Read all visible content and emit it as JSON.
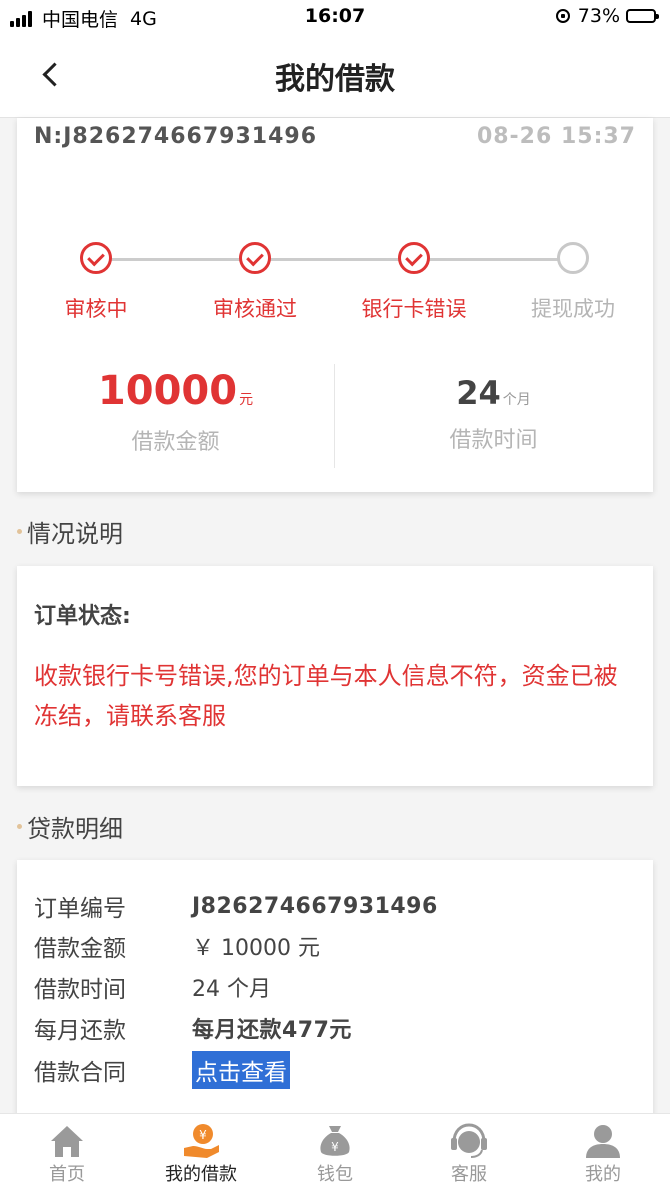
{
  "status_bar": {
    "carrier": "中国电信",
    "network": "4G",
    "time": "16:07",
    "battery": "73%"
  },
  "header": {
    "title": "我的借款"
  },
  "order": {
    "number": "N:J826274667931496",
    "time": "08-26 15:37",
    "steps": [
      {
        "label": "审核中",
        "done": true
      },
      {
        "label": "审核通过",
        "done": true
      },
      {
        "label": "银行卡错误",
        "done": true
      },
      {
        "label": "提现成功",
        "done": false
      }
    ],
    "amount": {
      "value": "10000",
      "unit": "元",
      "label": "借款金额"
    },
    "duration": {
      "value": "24",
      "unit": "个月",
      "label": "借款时间"
    }
  },
  "situation": {
    "title": "情况说明",
    "status_label": "订单状态:",
    "status_text": "收款银行卡号错误,您的订单与本人信息不符，资金已被冻结，请联系客服"
  },
  "details": {
    "title": "贷款明细",
    "rows": [
      {
        "key": "订单编号",
        "value": "J826274667931496"
      },
      {
        "key": "借款金额",
        "value": "￥ 10000 元"
      },
      {
        "key": "借款时间",
        "value": "24 个月"
      },
      {
        "key": "每月还款",
        "value": "每月还款477元"
      }
    ],
    "contract": {
      "key": "借款合同",
      "link_label": "点击查看"
    }
  },
  "tabs": [
    {
      "label": "首页",
      "icon": "home-icon"
    },
    {
      "label": "我的借款",
      "icon": "loan-icon"
    },
    {
      "label": "钱包",
      "icon": "wallet-icon"
    },
    {
      "label": "客服",
      "icon": "support-icon"
    },
    {
      "label": "我的",
      "icon": "user-icon"
    }
  ],
  "colors": {
    "accent_red": "#e03434",
    "active_tab": "#f08a2c",
    "link_bg": "#2f6fd6"
  }
}
